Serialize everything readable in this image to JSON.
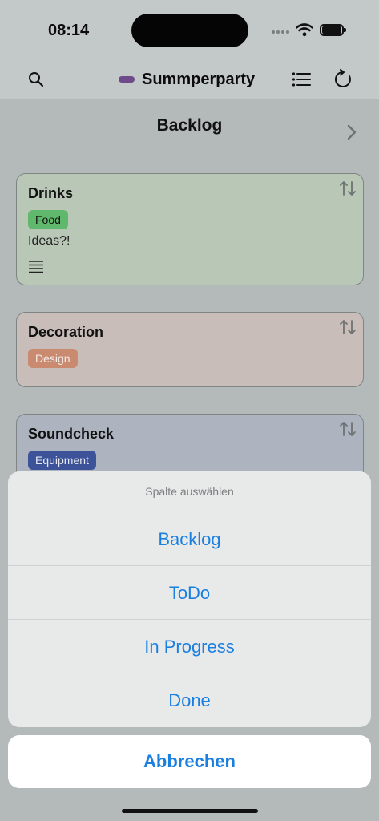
{
  "status_bar": {
    "time": "08:14"
  },
  "nav": {
    "title": "Summperparty",
    "title_dot_color": "#6e4a8a",
    "icons": [
      "search-icon",
      "list-icon",
      "refresh-icon"
    ]
  },
  "board": {
    "column_title": "Backlog",
    "cards": [
      {
        "title": "Drinks",
        "tag": "Food",
        "tag_color": "#5fb86b",
        "card_color": "#b9c7b6",
        "description": "Ideas?!"
      },
      {
        "title": "Decoration",
        "tag": "Design",
        "tag_color": "#c98a70",
        "card_color": "#c8bdb8"
      },
      {
        "title": "Soundcheck",
        "tag": "Equipment",
        "tag_color": "#3c539a",
        "card_color": "#aeb3c0"
      }
    ]
  },
  "action_sheet": {
    "header": "Spalte auswählen",
    "options": [
      "Backlog",
      "ToDo",
      "In Progress",
      "Done"
    ],
    "cancel_label": "Abbrechen"
  }
}
